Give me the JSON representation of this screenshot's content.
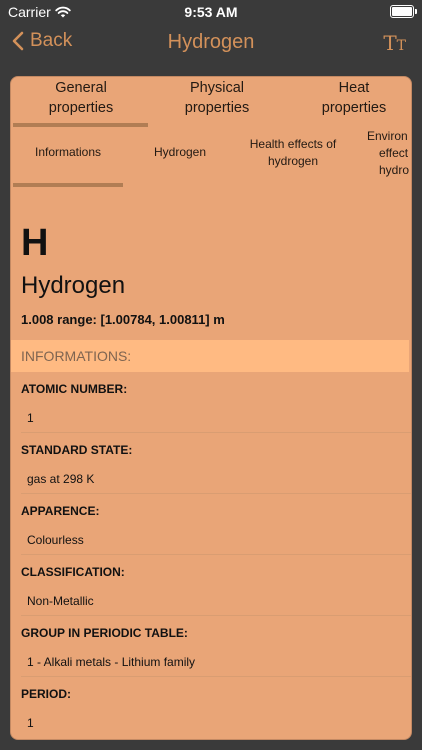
{
  "status_bar": {
    "carrier": "Carrier",
    "time": "9:53 AM"
  },
  "nav": {
    "back_label": "Back",
    "title": "Hydrogen",
    "text_size_big": "T",
    "text_size_small": "T"
  },
  "tabs_top": [
    {
      "line1": "General",
      "line2": "properties"
    },
    {
      "line1": "Physical",
      "line2": "properties"
    },
    {
      "line1": "Heat",
      "line2": "properties"
    }
  ],
  "tabs_sub": [
    {
      "line1": "Informations",
      "line2": ""
    },
    {
      "line1": "Hydrogen",
      "line2": ""
    },
    {
      "line1": "Health effects of",
      "line2": "hydrogen"
    },
    {
      "line1": "Environ",
      "line2": "effect",
      "line3": "hydro"
    }
  ],
  "element": {
    "symbol": "H",
    "name": "Hydrogen",
    "weight": "1.008 range: [1.00784, 1.00811] m"
  },
  "section": {
    "title": "INFORMATIONS:"
  },
  "rows": [
    {
      "label": "ATOMIC NUMBER:",
      "value": "1"
    },
    {
      "label": "STANDARD STATE:",
      "value": "gas at 298 K"
    },
    {
      "label": "APPARENCE:",
      "value": "Colourless"
    },
    {
      "label": "CLASSIFICATION:",
      "value": "Non-Metallic"
    },
    {
      "label": "GROUP IN PERIODIC TABLE:",
      "value": "1 - Alkali metals - Lithium family"
    },
    {
      "label": "PERIOD:",
      "value": "1"
    }
  ],
  "colors": {
    "background": "#3a3a3a",
    "accent": "#d3915a",
    "card": "#e9a577",
    "section_header": "#ffba82",
    "indicator": "#b17d54"
  },
  "icons": {
    "wifi": "wifi-icon",
    "battery": "battery-icon",
    "back": "chevron-left-icon",
    "text_size": "text-size-icon"
  }
}
